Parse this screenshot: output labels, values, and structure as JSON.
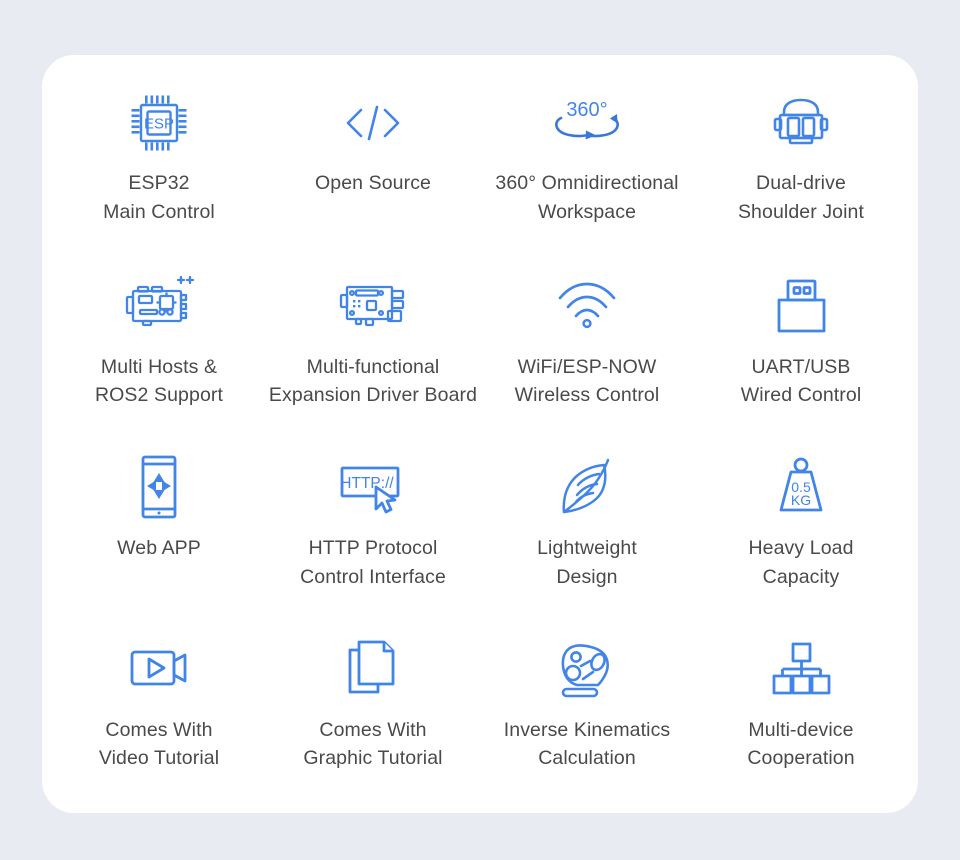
{
  "theme": {
    "page_background": "#e8ebf2",
    "card_background": "#ffffff",
    "icon_accent": "#4285e8",
    "icon_accent_dark": "#3a78d8",
    "label_color": "#4a4a4a"
  },
  "card": {
    "title": "",
    "features": [
      {
        "id": "esp32-main-control",
        "icon": "esp32-chip-icon",
        "icon_text": "ESP",
        "label": "ESP32\nMain Control",
        "label_line1": "ESP32",
        "label_line2": "Main Control"
      },
      {
        "id": "open-source",
        "icon": "code-brackets-icon",
        "icon_text": "</>",
        "label": "Open Source",
        "label_line1": "Open Source",
        "label_line2": ""
      },
      {
        "id": "360-omnidirectional-workspace",
        "icon": "rotation-360-icon",
        "icon_text": "360°",
        "label": "360° Omnidirectional\nWorkspace",
        "label_line1": "360° Omnidirectional",
        "label_line2": "Workspace"
      },
      {
        "id": "dual-drive-shoulder-joint",
        "icon": "dual-motor-joint-icon",
        "icon_text": "",
        "label": "Dual-drive\nShoulder Joint",
        "label_line1": "Dual-drive",
        "label_line2": "Shoulder Joint"
      },
      {
        "id": "multi-hosts-ros2-support",
        "icon": "multi-host-board-icon",
        "icon_text": "++",
        "label": "Multi Hosts &\nROS2 Support",
        "label_line1": "Multi Hosts &",
        "label_line2": "ROS2 Support"
      },
      {
        "id": "multi-functional-expansion-driver-board",
        "icon": "expansion-driver-board-icon",
        "icon_text": "",
        "label": "Multi-functional\nExpansion Driver Board",
        "label_line1": "Multi-functional",
        "label_line2": "Expansion Driver Board"
      },
      {
        "id": "wifi-espnow-wireless-control",
        "icon": "wifi-icon",
        "icon_text": "",
        "label": "WiFi/ESP-NOW\nWireless Control",
        "label_line1": "WiFi/ESP-NOW",
        "label_line2": "Wireless Control"
      },
      {
        "id": "uart-usb-wired-control",
        "icon": "usb-connector-icon",
        "icon_text": "",
        "label": "UART/USB\nWired Control",
        "label_line1": "UART/USB",
        "label_line2": "Wired Control"
      },
      {
        "id": "web-app",
        "icon": "tablet-dpad-icon",
        "icon_text": "",
        "label": "Web APP",
        "label_line1": "Web APP",
        "label_line2": ""
      },
      {
        "id": "http-protocol-control-interface",
        "icon": "http-cursor-icon",
        "icon_text": "HTTP://",
        "label": "HTTP Protocol\nControl Interface",
        "label_line1": "HTTP Protocol",
        "label_line2": "Control Interface"
      },
      {
        "id": "lightweight-design",
        "icon": "feather-icon",
        "icon_text": "",
        "label": "Lightweight\nDesign",
        "label_line1": "Lightweight",
        "label_line2": "Design"
      },
      {
        "id": "heavy-load-capacity",
        "icon": "weight-icon",
        "icon_text": "0.5 KG",
        "icon_text_line1": "0.5",
        "icon_text_line2": "KG",
        "label": "Heavy Load\nCapacity",
        "label_line1": "Heavy Load",
        "label_line2": "Capacity"
      },
      {
        "id": "comes-with-video-tutorial",
        "icon": "video-camera-icon",
        "icon_text": "",
        "label": "Comes With\nVideo Tutorial",
        "label_line1": "Comes With",
        "label_line2": "Video Tutorial"
      },
      {
        "id": "comes-with-graphic-tutorial",
        "icon": "documents-icon",
        "icon_text": "",
        "label": "Comes With\nGraphic Tutorial",
        "label_line1": "Comes With",
        "label_line2": "Graphic Tutorial"
      },
      {
        "id": "inverse-kinematics-calculation",
        "icon": "robot-arm-joints-icon",
        "icon_text": "",
        "label": "Inverse Kinematics\nCalculation",
        "label_line1": "Inverse Kinematics",
        "label_line2": "Calculation"
      },
      {
        "id": "multi-device-cooperation",
        "icon": "device-hierarchy-icon",
        "icon_text": "",
        "label": "Multi-device\nCooperation",
        "label_line1": "Multi-device",
        "label_line2": "Cooperation"
      }
    ]
  }
}
